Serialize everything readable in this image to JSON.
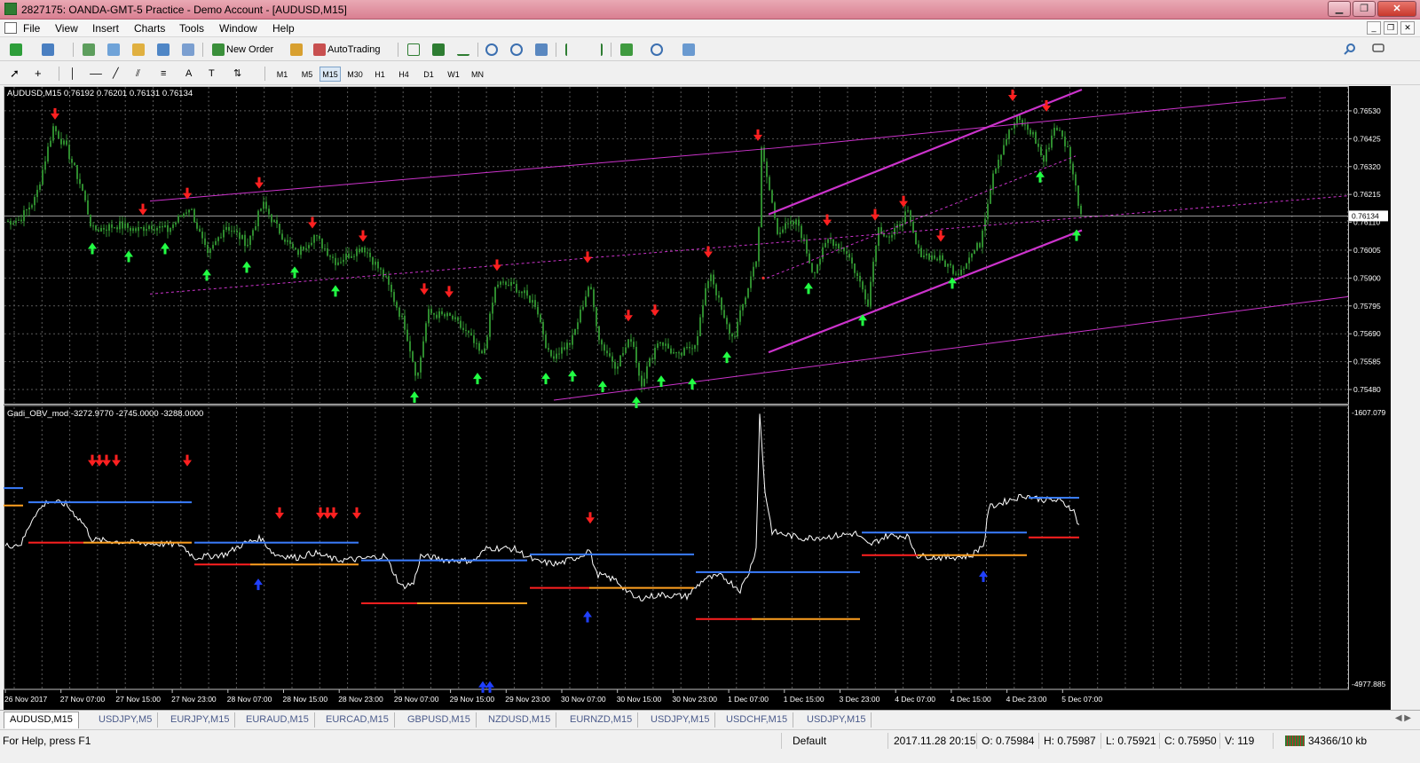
{
  "window": {
    "title": "2827175: OANDA-GMT-5 Practice - Demo Account - [AUDUSD,M15]"
  },
  "menu": [
    "File",
    "View",
    "Insert",
    "Charts",
    "Tools",
    "Window",
    "Help"
  ],
  "toolbar": {
    "new_order_label": "New Order",
    "autotrading_label": "AutoTrading",
    "timeframes": [
      "M1",
      "M5",
      "M15",
      "M30",
      "H1",
      "H4",
      "D1",
      "W1",
      "MN"
    ],
    "active_timeframe": "M15"
  },
  "main_chart": {
    "header": "AUDUSD,M15  0.76192 0.76201 0.76131 0.76134",
    "price_labels": [
      "0.76530",
      "0.76425",
      "0.76320",
      "0.76215",
      "0.76110",
      "0.76005",
      "0.75900",
      "0.75795",
      "0.75690",
      "0.75585",
      "0.75480"
    ],
    "current_price": "0.76134",
    "price_range": [
      0.7543,
      0.7661
    ],
    "candle_color": "#2e8b2e",
    "sell_arrow_color": "#ff2020",
    "buy_arrow_color": "#22ff44",
    "channel_color": "#cc33cc"
  },
  "indicator": {
    "header": "Gadi_OBV_mod -3272.9770 -2745.0000 -3288.0000",
    "top_label": "-1607.079",
    "bottom_label": "-4977.885",
    "value_range": [
      -5050,
      -1560
    ],
    "line_color": "#ffffff"
  },
  "time_labels": [
    "26 Nov 2017",
    "27 Nov 07:00",
    "27 Nov 15:00",
    "27 Nov 23:00",
    "28 Nov 07:00",
    "28 Nov 15:00",
    "28 Nov 23:00",
    "29 Nov 07:00",
    "29 Nov 15:00",
    "29 Nov 23:00",
    "30 Nov 07:00",
    "30 Nov 15:00",
    "30 Nov 23:00",
    "1 Dec 07:00",
    "1 Dec 15:00",
    "3 Dec 23:00",
    "4 Dec 07:00",
    "4 Dec 15:00",
    "4 Dec 23:00",
    "5 Dec 07:00"
  ],
  "tabs": [
    "AUDUSD,M15",
    "USDJPY,M5",
    "EURJPY,M15",
    "EURAUD,M15",
    "EURCAD,M15",
    "GBPUSD,M15",
    "NZDUSD,M15",
    "EURNZD,M15",
    "USDJPY,M15",
    "USDCHF,M15",
    "USDJPY,M15"
  ],
  "active_tab": "AUDUSD,M15",
  "status": {
    "help": "For Help, press F1",
    "profile": "Default",
    "datetime": "2017.11.28 20:15",
    "open": "O: 0.75984",
    "high": "H: 0.75987",
    "low": "L: 0.75921",
    "close": "C: 0.75950",
    "volume": "V: 119",
    "connection": "34366/10 kb"
  }
}
